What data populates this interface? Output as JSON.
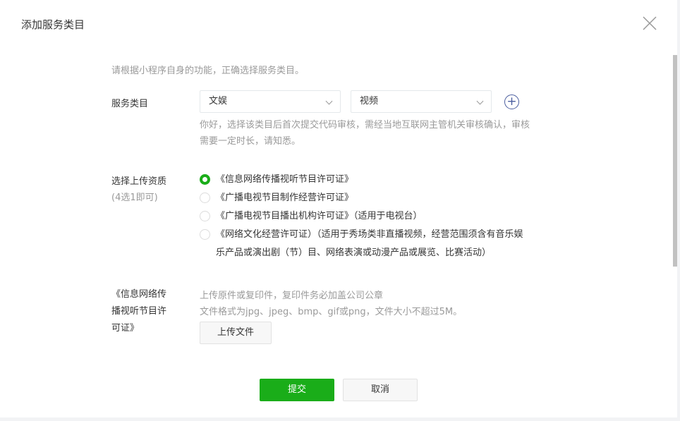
{
  "dialog": {
    "title": "添加服务类目"
  },
  "intro": "请根据小程序自身的功能，正确选择服务类目。",
  "category": {
    "label": "服务类目",
    "primary": "文娱",
    "secondary": "视频",
    "note_line1": "你好，选择该类目后首次提交代码审核，需经当地互联网主管机关审核确认，审核",
    "note_line2": "需要一定时长，请知悉。"
  },
  "qualification": {
    "label": "选择上传资质",
    "hint": "(4选1即可)",
    "options": [
      {
        "label": "《信息网络传播视听节目许可证》",
        "selected": true
      },
      {
        "label": "《广播电视节目制作经营许可证》",
        "selected": false
      },
      {
        "label": "《广播电视节目播出机构许可证》（适用于电视台）",
        "selected": false
      },
      {
        "label": "《网络文化经营许可证）（适用于秀场类非直播视频，经营范围须含有音乐娱",
        "label2": "乐产品或演出剧（节）目、网络表演或动漫产品或展览、比赛活动）",
        "selected": false
      }
    ]
  },
  "upload": {
    "label_lines": [
      "《信息网络传",
      "播视听节目许",
      "可证》"
    ],
    "hint1": "上传原件或复印件，复印件务必加盖公司公章",
    "hint2": "文件格式为jpg、jpeg、bmp、gif或png，文件大小不超过5M。",
    "button": "上传文件"
  },
  "footer": {
    "submit": "提交",
    "cancel": "取消"
  },
  "colors": {
    "accent": "#1aad19",
    "plus": "#4b5e9f"
  }
}
